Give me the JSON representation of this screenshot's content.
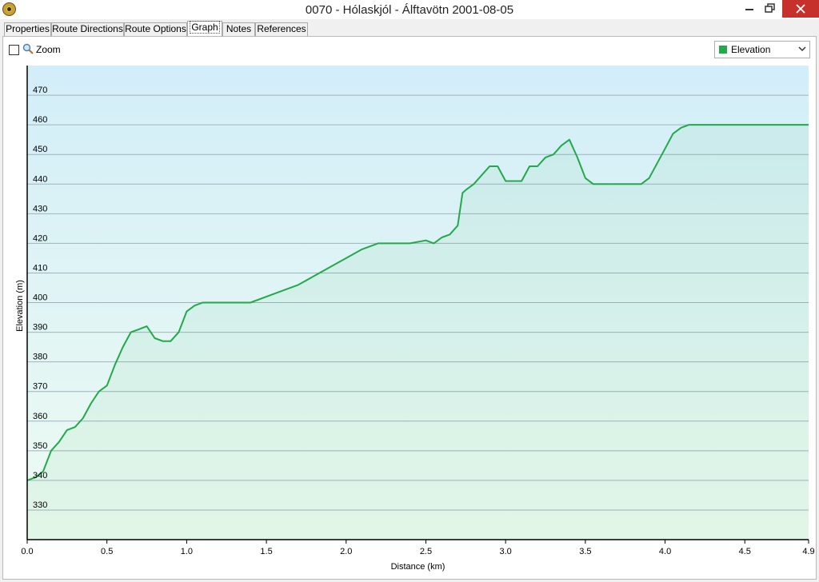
{
  "window": {
    "title": "0070 - Hólaskjól - Álftavötn 2001-08-05"
  },
  "tabs": [
    {
      "label": "Properties",
      "active": false
    },
    {
      "label": "Route Directions",
      "active": false
    },
    {
      "label": "Route Options",
      "active": false
    },
    {
      "label": "Graph",
      "active": true
    },
    {
      "label": "Notes",
      "active": false
    },
    {
      "label": "References",
      "active": false
    }
  ],
  "toolbar": {
    "zoom_label": "Zoom",
    "zoom_checked": false,
    "series_selected": "Elevation",
    "series_color": "#22a94a"
  },
  "colors": {
    "line": "#22a94a",
    "grid": "#9fb3bd",
    "bg_top": "#d2eef8",
    "bg_bottom": "#eefbf2"
  },
  "chart_data": {
    "type": "area",
    "xlabel": "Distance  (km)",
    "ylabel": "Elevation (m)",
    "xlim": [
      0,
      4.9
    ],
    "ylim": [
      320,
      480
    ],
    "xticks": [
      "0.0",
      "0.5",
      "1.0",
      "1.5",
      "2.0",
      "2.5",
      "3.0",
      "3.5",
      "4.0",
      "4.5",
      "4.9"
    ],
    "yticks": [
      "330",
      "340",
      "350",
      "360",
      "370",
      "380",
      "390",
      "400",
      "410",
      "420",
      "430",
      "440",
      "450",
      "460",
      "470"
    ],
    "series": [
      {
        "x": [
          0,
          0.05,
          0.1,
          0.15,
          0.2,
          0.25,
          0.3,
          0.35,
          0.4,
          0.45,
          0.5,
          0.55,
          0.6,
          0.65,
          0.7,
          0.75,
          0.8,
          0.85,
          0.9,
          0.95,
          1.0,
          1.05,
          1.1,
          1.2,
          1.3,
          1.4,
          1.5,
          1.6,
          1.7,
          1.8,
          1.9,
          2.0,
          2.1,
          2.2,
          2.3,
          2.4,
          2.5,
          2.55,
          2.6,
          2.65,
          2.7,
          2.73,
          2.75,
          2.8,
          2.85,
          2.9,
          2.95,
          3.0,
          3.05,
          3.1,
          3.15,
          3.2,
          3.25,
          3.3,
          3.35,
          3.4,
          3.45,
          3.5,
          3.55,
          3.6,
          3.7,
          3.8,
          3.85,
          3.9,
          3.95,
          4.0,
          4.05,
          4.1,
          4.15,
          4.2,
          4.3,
          4.4,
          4.5,
          4.6,
          4.7,
          4.8,
          4.9
        ],
        "y": [
          340,
          341,
          343,
          350,
          353,
          357,
          358,
          361,
          366,
          370,
          372,
          379,
          385,
          390,
          391,
          392,
          388,
          387,
          387,
          390,
          397,
          399,
          400,
          400,
          400,
          400,
          402,
          404,
          406,
          409,
          412,
          415,
          418,
          420,
          420,
          420,
          421,
          420,
          422,
          423,
          426,
          437,
          438,
          440,
          443,
          446,
          446,
          441,
          441,
          441,
          446,
          446,
          449,
          450,
          453,
          455,
          449,
          442,
          440,
          440,
          440,
          440,
          440,
          442,
          447,
          452,
          457,
          459,
          460,
          460,
          460,
          460,
          460,
          460,
          460,
          460,
          460
        ]
      }
    ]
  }
}
